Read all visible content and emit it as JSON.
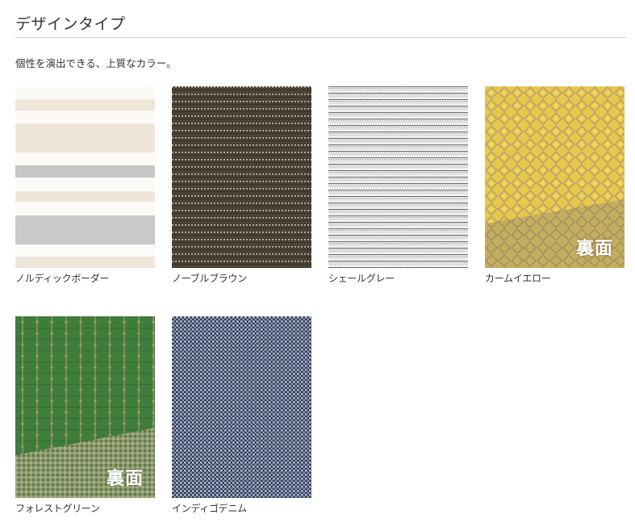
{
  "section": {
    "title": "デザインタイプ",
    "lead": "個性を演出できる、上質なカラー。"
  },
  "swatches": [
    {
      "name": "ノルディックボーダー",
      "back_label": ""
    },
    {
      "name": "ノーブルブラウン",
      "back_label": ""
    },
    {
      "name": "シェールグレー",
      "back_label": ""
    },
    {
      "name": "カームイエロー",
      "back_label": "裏面"
    },
    {
      "name": "フォレストグリーン",
      "back_label": "裏面"
    },
    {
      "name": "インディゴデニム",
      "back_label": ""
    }
  ],
  "colors": {
    "nordic_cream": "#efe6da",
    "nordic_gray": "#c6c6c6",
    "noble_brown": "#4a3f33",
    "shale_gray": "#e4e4e4",
    "calm_yellow": "#e8c84a",
    "forest_green": "#3f7d3d",
    "indigo_denim": "#2f3b5c"
  }
}
